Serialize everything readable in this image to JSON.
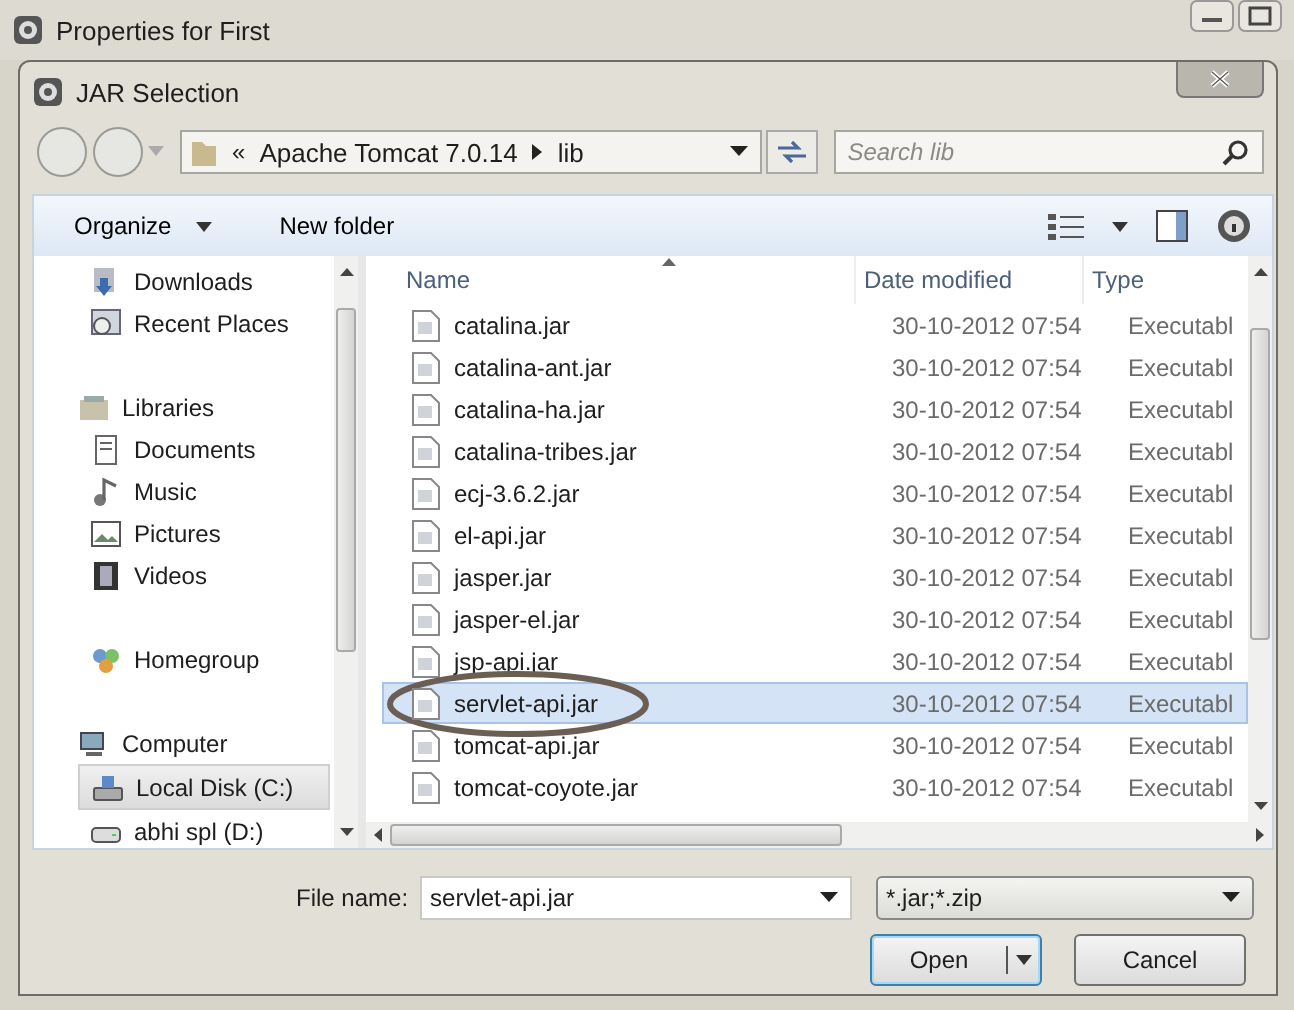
{
  "window": {
    "title": "Properties for First"
  },
  "dialog": {
    "title": "JAR Selection"
  },
  "address": {
    "overflow": "«",
    "path": [
      "Apache Tomcat 7.0.14",
      "lib"
    ]
  },
  "search": {
    "placeholder": "Search lib"
  },
  "toolbar": [
    {
      "label": "Organize",
      "menu": true
    },
    {
      "label": "New folder",
      "menu": false
    }
  ],
  "sidebar": {
    "items": [
      {
        "label": "Downloads",
        "kind": "downloads",
        "selected": false
      },
      {
        "label": "Recent Places",
        "kind": "recent",
        "selected": false
      },
      {
        "label": "Libraries",
        "kind": "libraries",
        "selected": false,
        "children": [
          {
            "label": "Documents",
            "kind": "documents",
            "selected": false
          },
          {
            "label": "Music",
            "kind": "music",
            "selected": false
          },
          {
            "label": "Pictures",
            "kind": "pictures",
            "selected": false
          },
          {
            "label": "Videos",
            "kind": "videos",
            "selected": false
          }
        ]
      },
      {
        "label": "Homegroup",
        "kind": "homegroup",
        "selected": false
      },
      {
        "label": "Computer",
        "kind": "computer",
        "selected": false,
        "children": [
          {
            "label": "Local Disk (C:)",
            "kind": "disk",
            "selected": true
          },
          {
            "label": "abhi spl (D:)",
            "kind": "drive",
            "selected": false
          }
        ]
      }
    ]
  },
  "table": {
    "columns": [
      "Name",
      "Date modified",
      "Type"
    ],
    "rows": [
      {
        "name": "catalina.jar",
        "date": "30-10-2012 07:54",
        "type": "Executabl",
        "selected": false,
        "circled": false
      },
      {
        "name": "catalina-ant.jar",
        "date": "30-10-2012 07:54",
        "type": "Executabl",
        "selected": false,
        "circled": false
      },
      {
        "name": "catalina-ha.jar",
        "date": "30-10-2012 07:54",
        "type": "Executabl",
        "selected": false,
        "circled": false
      },
      {
        "name": "catalina-tribes.jar",
        "date": "30-10-2012 07:54",
        "type": "Executabl",
        "selected": false,
        "circled": false
      },
      {
        "name": "ecj-3.6.2.jar",
        "date": "30-10-2012 07:54",
        "type": "Executabl",
        "selected": false,
        "circled": false
      },
      {
        "name": "el-api.jar",
        "date": "30-10-2012 07:54",
        "type": "Executabl",
        "selected": false,
        "circled": false
      },
      {
        "name": "jasper.jar",
        "date": "30-10-2012 07:54",
        "type": "Executabl",
        "selected": false,
        "circled": false
      },
      {
        "name": "jasper-el.jar",
        "date": "30-10-2012 07:54",
        "type": "Executabl",
        "selected": false,
        "circled": false
      },
      {
        "name": "jsp-api.jar",
        "date": "30-10-2012 07:54",
        "type": "Executabl",
        "selected": false,
        "circled": false
      },
      {
        "name": "servlet-api.jar",
        "date": "30-10-2012 07:54",
        "type": "Executabl",
        "selected": true,
        "circled": true
      },
      {
        "name": "tomcat-api.jar",
        "date": "30-10-2012 07:54",
        "type": "Executabl",
        "selected": false,
        "circled": false
      },
      {
        "name": "tomcat-coyote.jar",
        "date": "30-10-2012 07:54",
        "type": "Executabl",
        "selected": false,
        "circled": false
      }
    ]
  },
  "file_name": {
    "label": "File name:",
    "value": "servlet-api.jar"
  },
  "file_type": {
    "value": "*.jar;*.zip"
  },
  "buttons": [
    {
      "label": "Open",
      "kind": "split",
      "default": true
    },
    {
      "label": "Cancel",
      "kind": "plain",
      "default": false
    }
  ]
}
